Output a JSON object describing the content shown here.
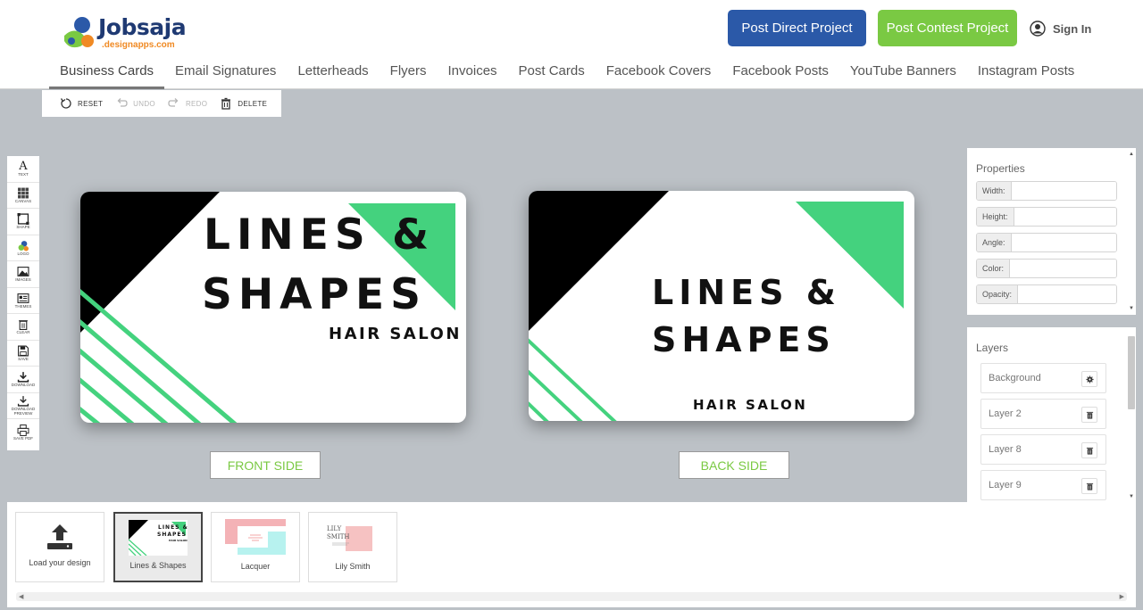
{
  "brand": {
    "name": "Jobsaja",
    "sub": ".designapps.com"
  },
  "header": {
    "post_direct": "Post Direct Project",
    "post_contest": "Post Contest Project",
    "sign_in": "Sign In"
  },
  "nav": {
    "items": [
      "Business Cards",
      "Email Signatures",
      "Letterheads",
      "Flyers",
      "Invoices",
      "Post Cards",
      "Facebook Covers",
      "Facebook Posts",
      "YouTube Banners",
      "Instagram Posts"
    ],
    "active": "Business Cards"
  },
  "toolbar": {
    "reset": "RESET",
    "undo": "UNDO",
    "redo": "REDO",
    "delete": "DELETE"
  },
  "sidetools": {
    "text": "TEXT",
    "canvas": "CANVAS",
    "shape": "SHAPE",
    "logo": "LOGO",
    "images": "IMAGES",
    "themes": "THEMES",
    "clear": "CLEAR",
    "save": "SAVE",
    "download": "DOWNLOAD",
    "download_preview": "DOWNLOAD PREVIEW",
    "save_pdf": "SAVE PDF"
  },
  "cards": {
    "front": {
      "line1": "LINES &",
      "line2": "SHAPES",
      "line3": "HAIR SALON"
    },
    "back": {
      "line1": "LINES &",
      "line2": "SHAPES",
      "line3": "HAIR SALON"
    },
    "front_label": "FRONT SIDE",
    "back_label": "BACK SIDE",
    "colors": {
      "accent": "#44d27e",
      "dark": "#000000"
    }
  },
  "properties": {
    "title": "Properties",
    "width": "Width:",
    "height": "Height:",
    "angle": "Angle:",
    "color": "Color:",
    "opacity": "Opacity:"
  },
  "layers": {
    "title": "Layers",
    "items": [
      "Background",
      "Layer 2",
      "Layer 8",
      "Layer 9"
    ]
  },
  "templates": {
    "load": "Load your design",
    "items": [
      "Lines & Shapes",
      "Lacquer",
      "Lily Smith"
    ],
    "lily_thumb": "LILY SMITH"
  },
  "colors": {
    "blue": "#2b59a8",
    "green": "#7ac943"
  }
}
